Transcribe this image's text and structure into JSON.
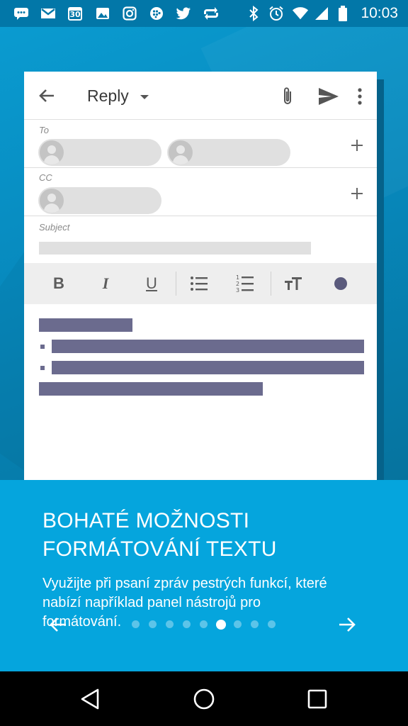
{
  "status_bar": {
    "time": "10:03",
    "notification_icons": [
      "messages-icon",
      "gmail-icon",
      "calendar-icon",
      "photos-icon",
      "instagram-icon",
      "blackberry-icon",
      "twitter-icon",
      "sync-icon"
    ],
    "calendar_day": "30",
    "system_icons": [
      "bluetooth-icon",
      "alarm-icon",
      "wifi-icon",
      "signal-icon",
      "battery-icon"
    ]
  },
  "mockup": {
    "title": "Reply",
    "to_label": "To",
    "cc_label": "CC",
    "subject_label": "Subject",
    "toolbar": {
      "bold": "B",
      "italic": "I",
      "underline": "U"
    }
  },
  "panel": {
    "heading": "BOHATÉ MOŽNOSTI FORMÁTOVÁNÍ TEXTU",
    "description": "Využijte při psaní zpráv pestrých funkcí, které nabízí například panel nástrojů pro formátování.",
    "page_count": 9,
    "active_page": 5
  },
  "colors": {
    "status_bar": "#0277a8",
    "panel": "#05a5dd",
    "placeholder_text": "#6b6b8e"
  }
}
